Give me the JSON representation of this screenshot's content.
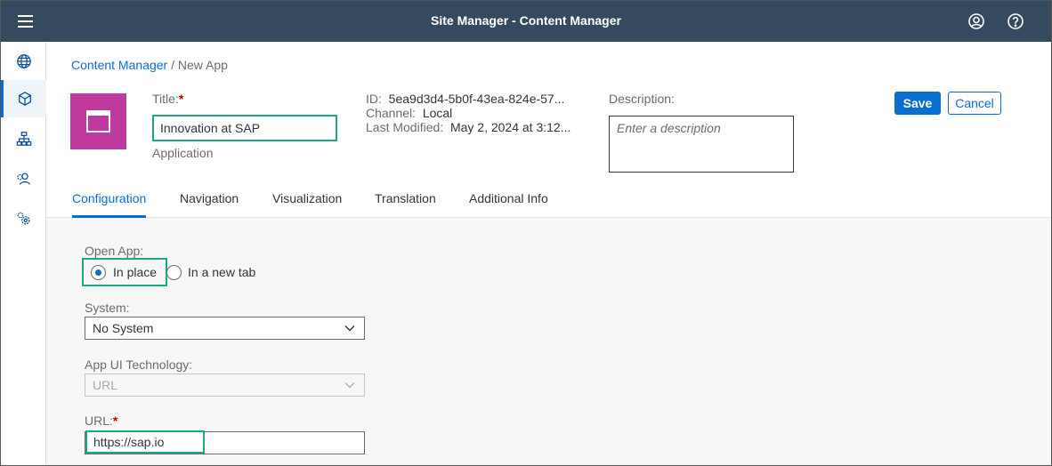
{
  "shell": {
    "title": "Site Manager - Content Manager",
    "icons": [
      "menu-icon",
      "user-icon",
      "help-icon"
    ]
  },
  "sidenav": {
    "items": [
      {
        "name": "globe-icon"
      },
      {
        "name": "cube-icon",
        "active": true
      },
      {
        "name": "hierarchy-icon"
      },
      {
        "name": "role-settings-icon"
      },
      {
        "name": "settings-icon"
      }
    ]
  },
  "breadcrumb": {
    "link": "Content Manager",
    "separator": "/",
    "current": "New App"
  },
  "header": {
    "title_label": "Title:",
    "required_mark": "*",
    "title_value": "Innovation at SAP",
    "subtitle": "Application",
    "id_label": "ID:",
    "id_value": "5ea9d3d4-5b0f-43ea-824e-57...",
    "channel_label": "Channel:",
    "channel_value": "Local",
    "modified_label": "Last Modified:",
    "modified_value": "May 2, 2024 at 3:12...",
    "description_label": "Description:",
    "description_placeholder": "Enter a description",
    "save_label": "Save",
    "cancel_label": "Cancel"
  },
  "tabs": [
    {
      "label": "Configuration",
      "active": true
    },
    {
      "label": "Navigation"
    },
    {
      "label": "Visualization"
    },
    {
      "label": "Translation"
    },
    {
      "label": "Additional Info"
    }
  ],
  "form": {
    "open_app_label": "Open App:",
    "open_app_options": [
      "In place",
      "In a new tab"
    ],
    "open_app_selected": "In place",
    "system_label": "System:",
    "system_value": "No System",
    "tech_label": "App UI Technology:",
    "tech_value": "URL",
    "url_label": "URL:",
    "url_value": "https://sap.io"
  },
  "colors": {
    "shell": "#354a5f",
    "accent": "#0a6ed1",
    "app_icon": "#c0399f",
    "highlight": "#1ea88a",
    "required": "#bb0000"
  }
}
